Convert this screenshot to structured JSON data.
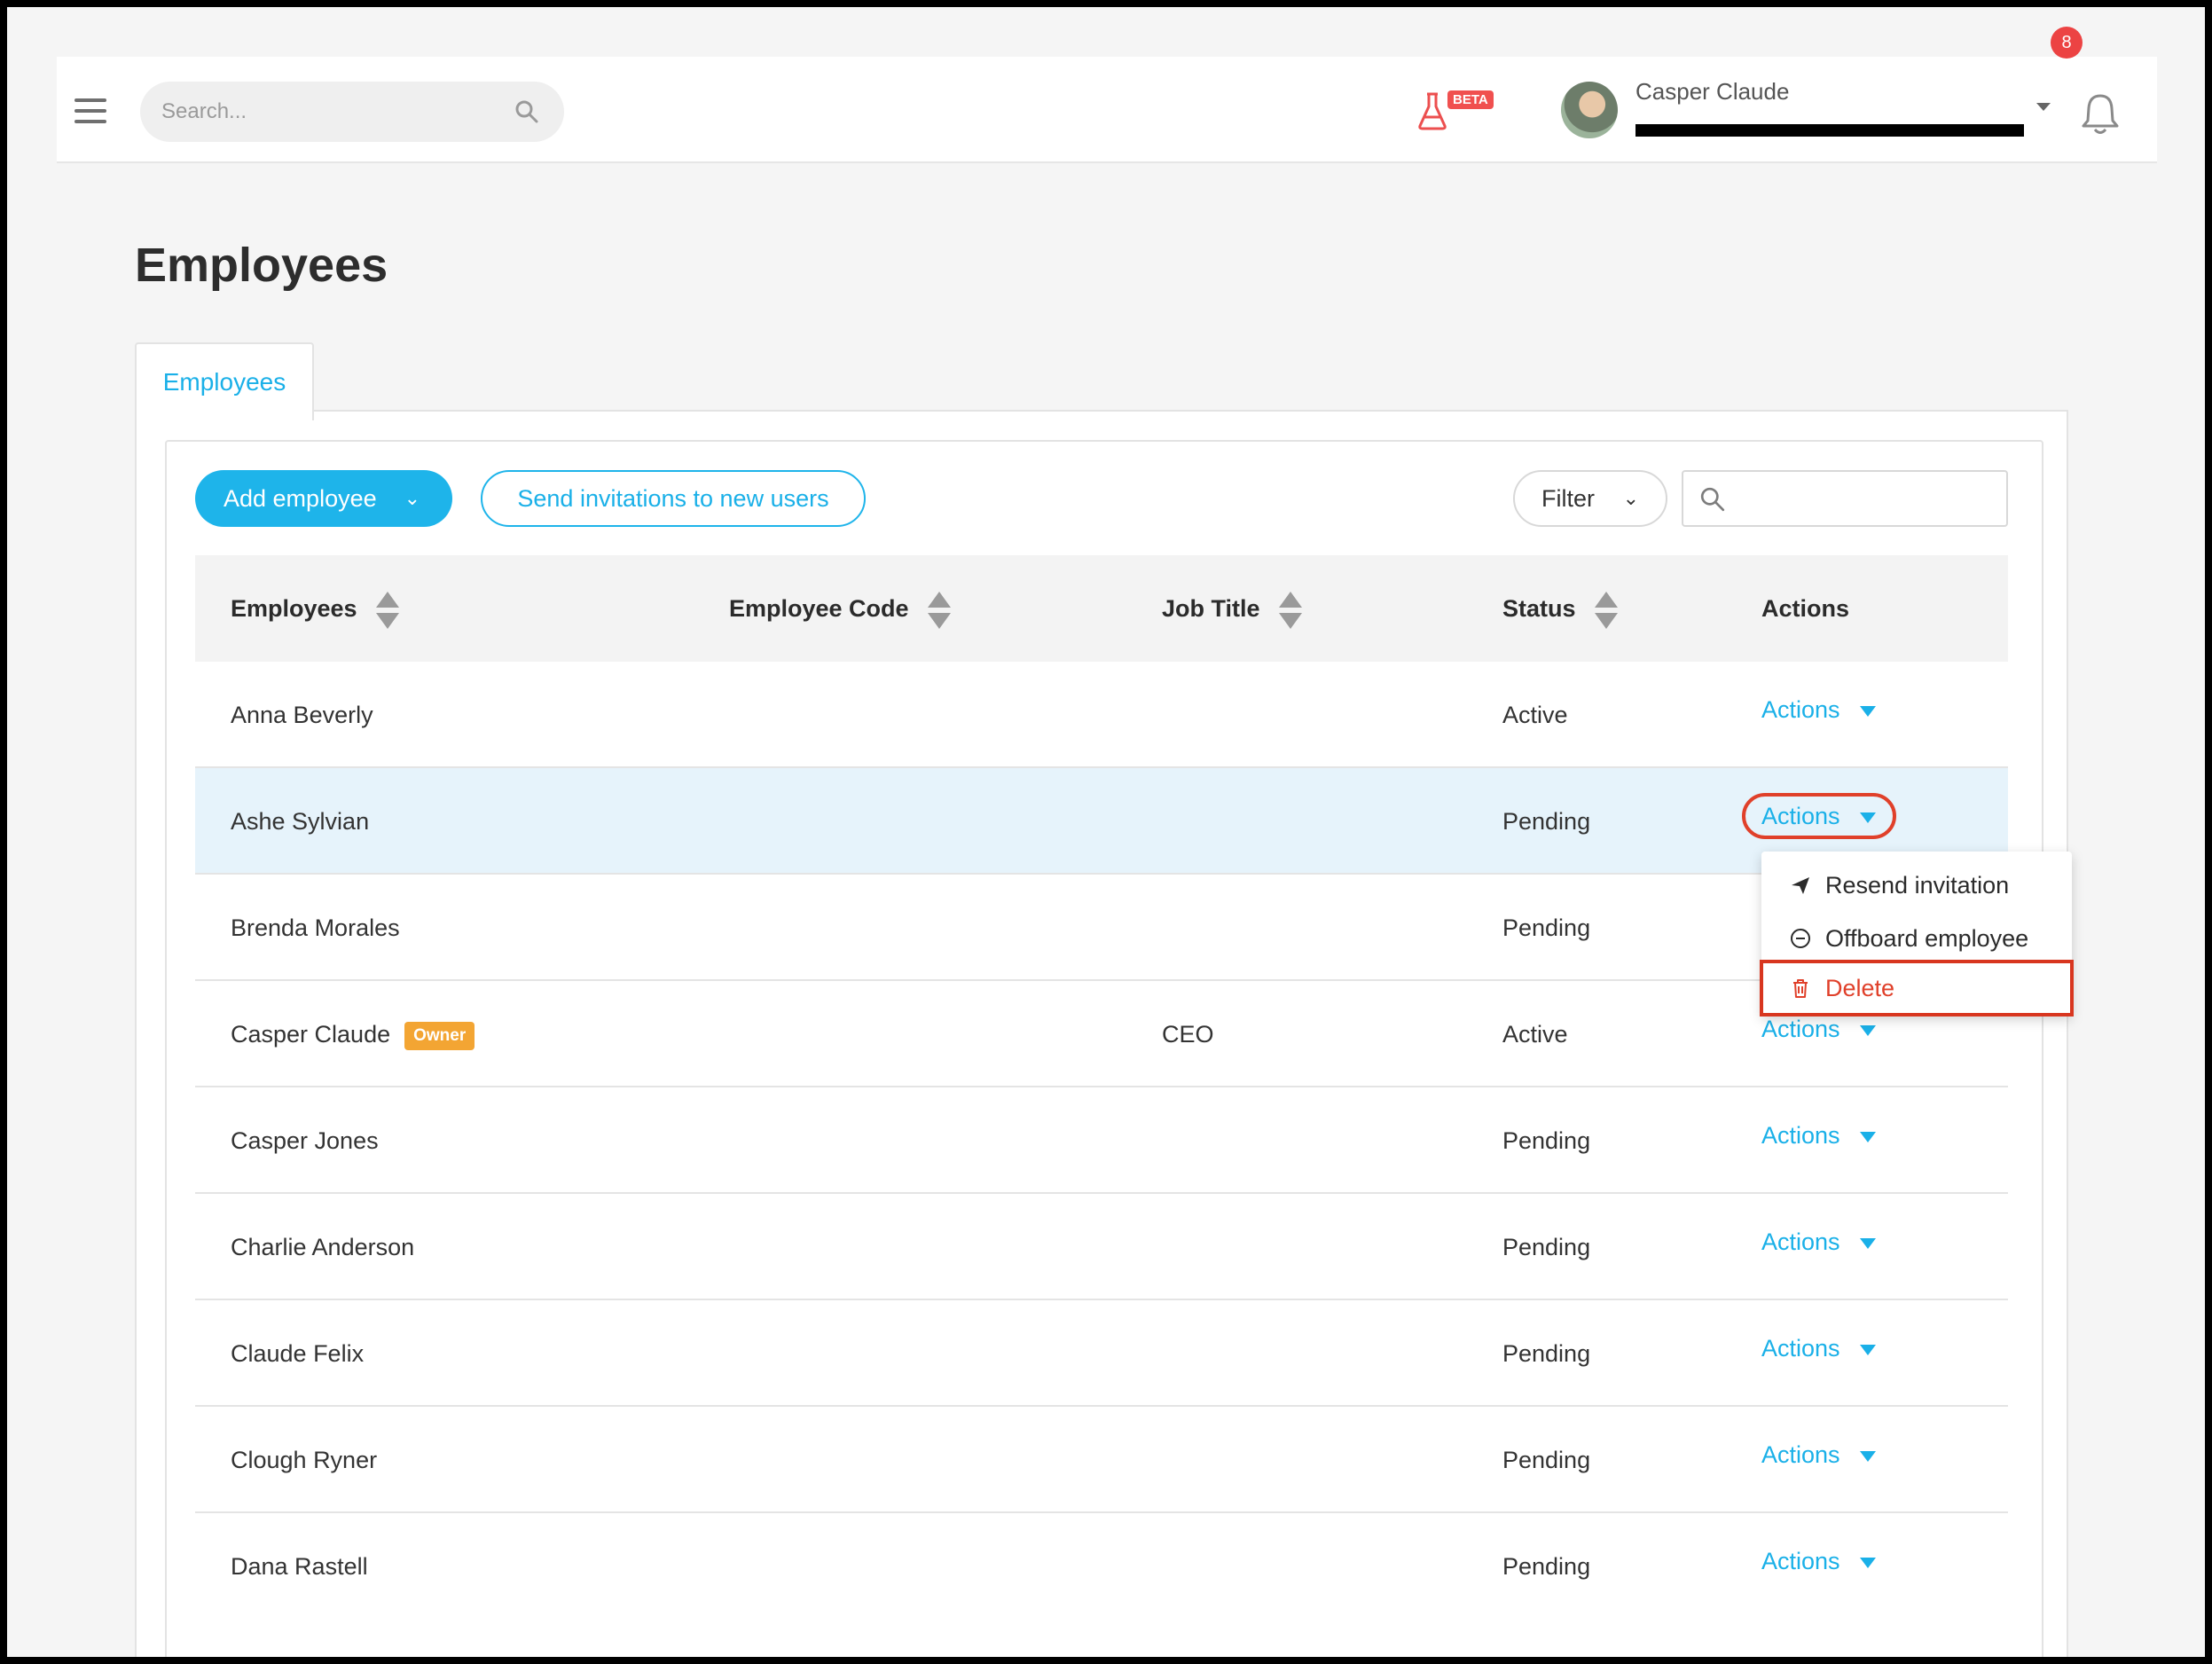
{
  "header": {
    "search_placeholder": "Search...",
    "beta_label": "BETA",
    "user_name": "Casper Claude",
    "notification_count": "8"
  },
  "page": {
    "title": "Employees"
  },
  "tabs": [
    {
      "label": "Employees"
    }
  ],
  "toolbar": {
    "add_employee_label": "Add employee",
    "send_invitations_label": "Send invitations to new users",
    "filter_label": "Filter",
    "search_placeholder": ""
  },
  "table": {
    "columns": [
      "Employees",
      "Employee Code",
      "Job Title",
      "Status",
      "Actions"
    ],
    "action_label": "Actions",
    "owner_badge": "Owner",
    "rows": [
      {
        "name": "Anna Beverly",
        "code": "",
        "job_title": "",
        "status": "Active"
      },
      {
        "name": "Ashe Sylvian",
        "code": "",
        "job_title": "",
        "status": "Pending"
      },
      {
        "name": "Brenda Morales",
        "code": "",
        "job_title": "",
        "status": "Pending"
      },
      {
        "name": "Casper Claude",
        "code": "",
        "job_title": "CEO",
        "status": "Active"
      },
      {
        "name": "Casper Jones",
        "code": "",
        "job_title": "",
        "status": "Pending"
      },
      {
        "name": "Charlie Anderson",
        "code": "",
        "job_title": "",
        "status": "Pending"
      },
      {
        "name": "Claude Felix",
        "code": "",
        "job_title": "",
        "status": "Pending"
      },
      {
        "name": "Clough Ryner",
        "code": "",
        "job_title": "",
        "status": "Pending"
      },
      {
        "name": "Dana Rastell",
        "code": "",
        "job_title": "",
        "status": "Pending"
      }
    ]
  },
  "dropdown": {
    "items": [
      {
        "label": "Resend invitation",
        "icon": "paper-plane-icon"
      },
      {
        "label": "Offboard employee",
        "icon": "minus-circle-icon"
      },
      {
        "label": "Delete",
        "icon": "trash-icon"
      }
    ]
  },
  "colors": {
    "accent": "#1eb4ea",
    "danger": "#e0402a",
    "owner_badge": "#f3a533",
    "highlight_row": "#e6f3fb"
  }
}
